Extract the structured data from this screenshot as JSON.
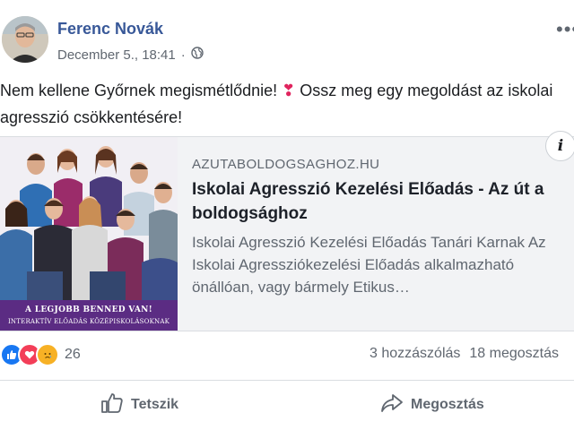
{
  "post": {
    "author": "Ferenc Novák",
    "date": "December 5., 18:41",
    "audience_icon": "globe-icon",
    "text_before": "Nem kellene Győrnek megismétlődnie! ",
    "text_after": " Ossz meg egy megoldást az iskolai agresszió csökkentésére!"
  },
  "link_card": {
    "domain": "AZUTABOLDOGSAGHOZ.HU",
    "title": "Iskolai Agresszió Kezelési Előadás - Az út a boldogsághoz",
    "description": "Iskolai Agresszió Kezelési Előadás Tanári Karnak Az Iskolai Agressziókezelési Előadás alkalmazható önállóan, vagy bármely Etikus…",
    "image_caption_1": "A LEGJOBB BENNED VAN!",
    "image_caption_2": "INTERAKTÍV ELŐADÁS KÖZÉPISKOLÁSOKNAK",
    "info_label": "i"
  },
  "engagement": {
    "reaction_count": "26",
    "comments": "3 hozzászólás",
    "shares": "18 megosztás"
  },
  "actions": {
    "like": "Tetszik",
    "share": "Megosztás"
  },
  "colors": {
    "author": "#385898",
    "like": "#1877f2",
    "love": "#f33e58",
    "sad": "#f7b125",
    "caption_bg": "#5b2c83"
  }
}
